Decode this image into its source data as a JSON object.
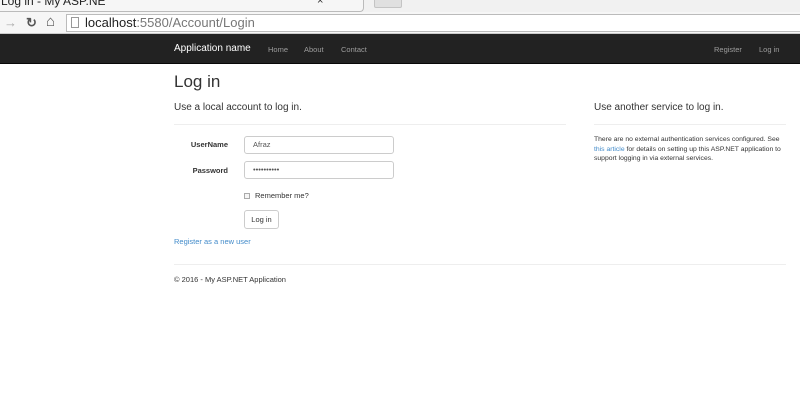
{
  "browser": {
    "tab_title": "Log in - My ASP.NE",
    "tab_close": "×",
    "url_host": "localhost",
    "url_path": ":5580/Account/Login",
    "back_icon": "←",
    "forward_icon": "→",
    "reload_icon": "↻",
    "home_icon": "⌂"
  },
  "navbar": {
    "brand": "Application name",
    "links": [
      "Home",
      "About",
      "Contact"
    ],
    "right_links": [
      "Register",
      "Log in"
    ]
  },
  "page": {
    "title": "Log in",
    "local_heading": "Use a local account to log in.",
    "external_heading": "Use another service to log in."
  },
  "form": {
    "username_label": "UserName",
    "username_value": "Afraz",
    "password_label": "Password",
    "password_value": "••••••••••",
    "remember_label": "Remember me?",
    "submit_label": "Log in",
    "register_link": "Register as a new user"
  },
  "external": {
    "text_before": "There are no external authentication services configured. See ",
    "link": "this article",
    "text_after": " for details on setting up this ASP.NET application to support logging in via external services."
  },
  "footer": {
    "text": "© 2016 - My ASP.NET Application"
  }
}
